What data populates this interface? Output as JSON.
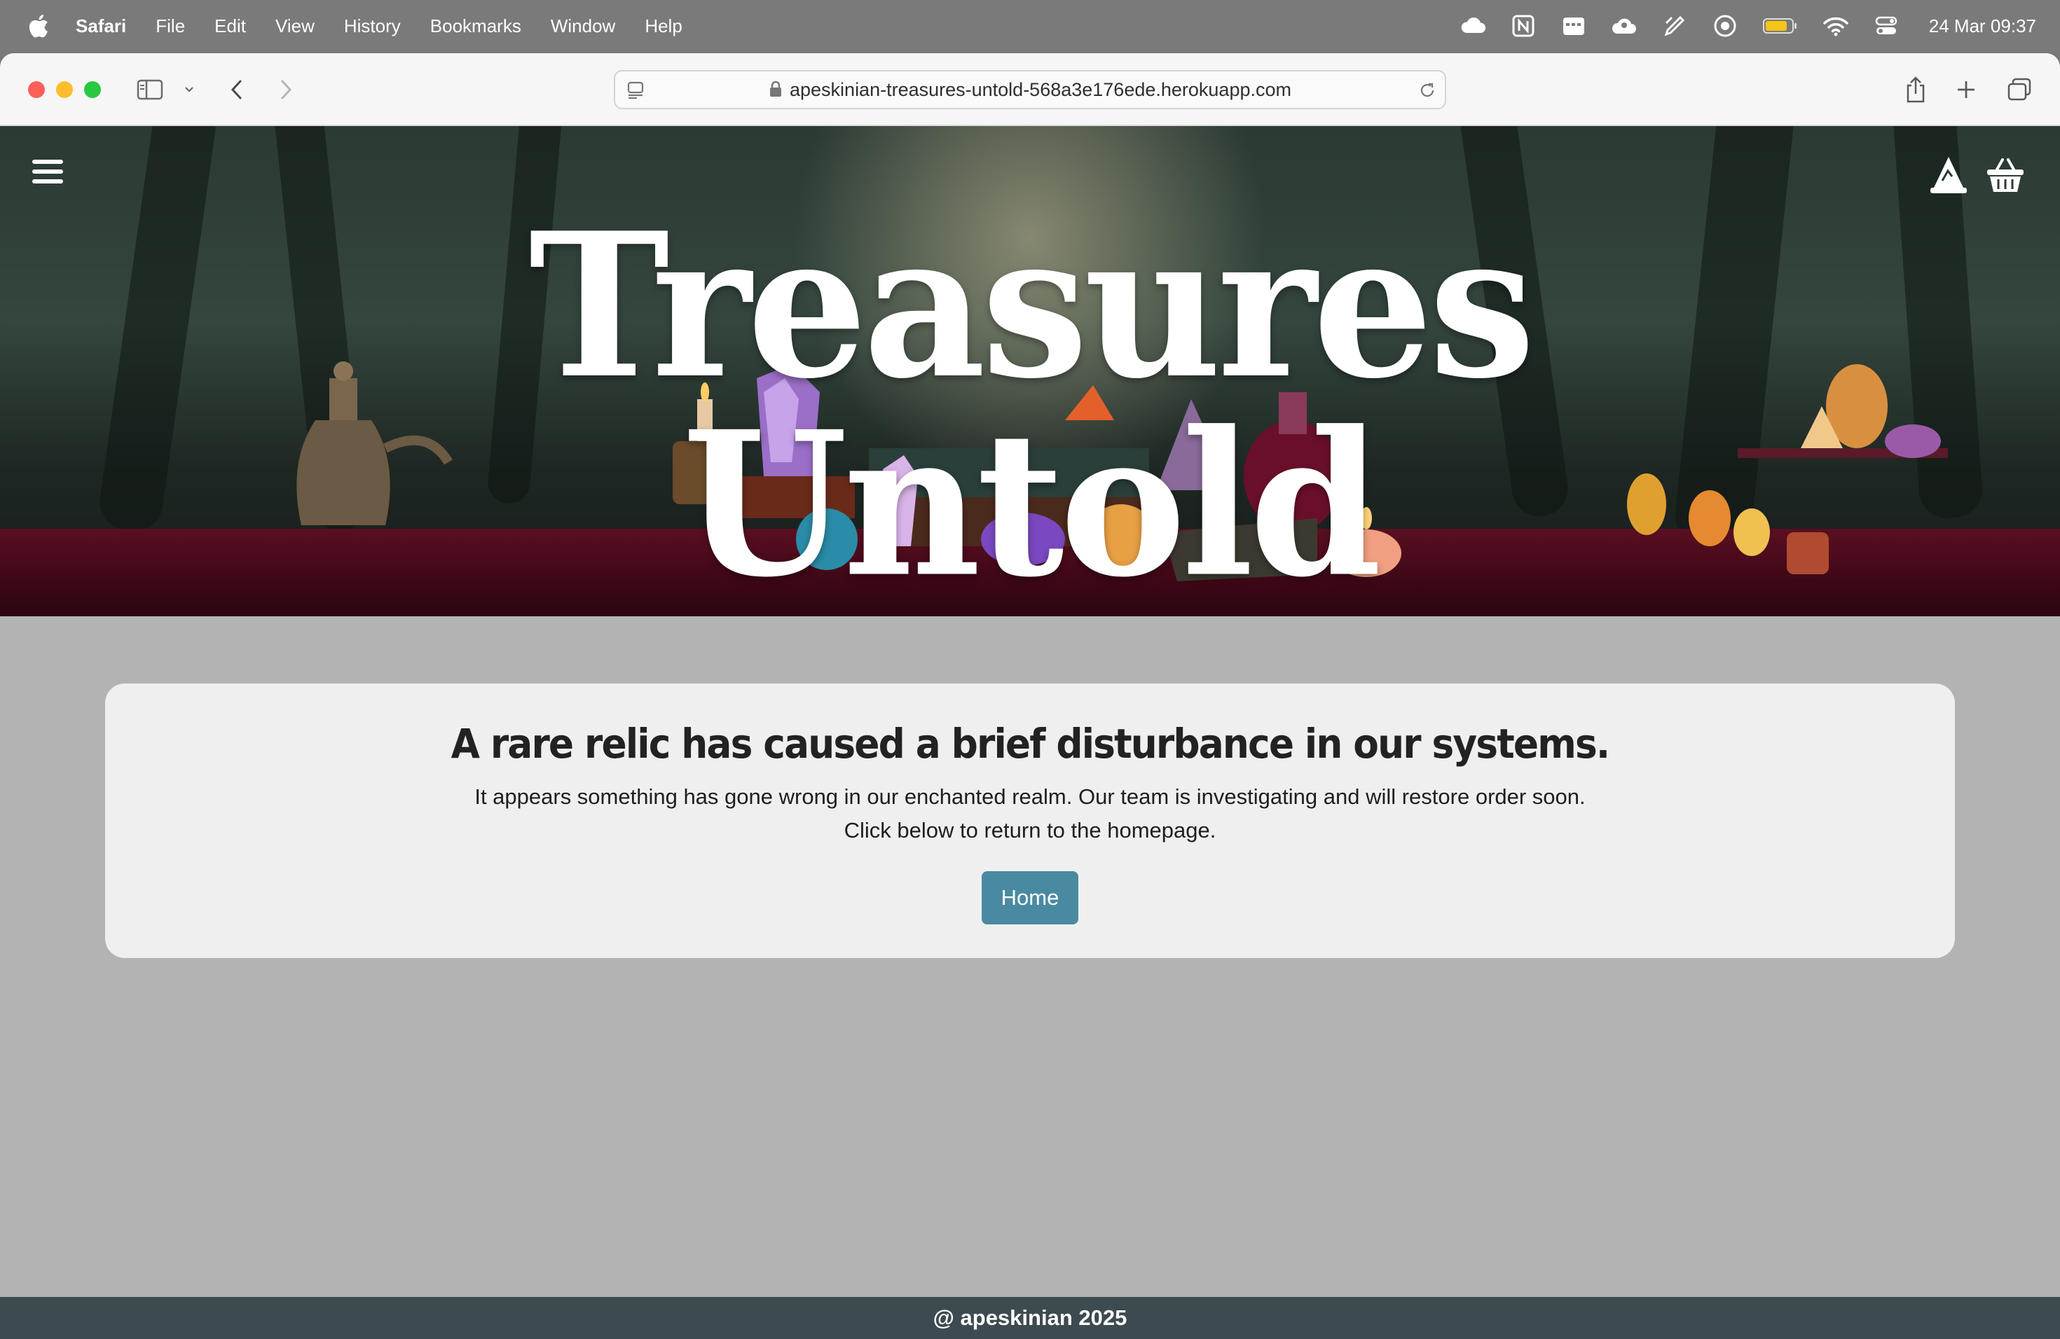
{
  "menubar": {
    "app_name": "Safari",
    "items": [
      "File",
      "Edit",
      "View",
      "History",
      "Bookmarks",
      "Window",
      "Help"
    ],
    "clock": "24 Mar  09:37",
    "status_icons": [
      "cloud-icon",
      "notion-icon",
      "calendar-icon",
      "cloud-sync-icon",
      "pen-icon",
      "record-icon",
      "battery-icon",
      "wifi-icon",
      "control-center-icon"
    ]
  },
  "browser": {
    "url": "apeskinian-treasures-untold-568a3e176ede.herokuapp.com",
    "traffic_colors": {
      "close": "#fe5f57",
      "minimize": "#febc2e",
      "maximize": "#28c840"
    }
  },
  "banner": {
    "title": "Treasures Untold",
    "icons": [
      "menu-icon",
      "wizard-hat-icon",
      "basket-icon"
    ]
  },
  "error": {
    "heading": "A rare relic has caused a brief disturbance in our systems.",
    "line1": "It appears something has gone wrong in our enchanted realm. Our team is investigating and will restore order soon.",
    "line2": "Click below to return to the homepage.",
    "button_label": "Home",
    "button_color": "#4a8aa0"
  },
  "footer": {
    "text": "@ apeskinian 2025"
  }
}
